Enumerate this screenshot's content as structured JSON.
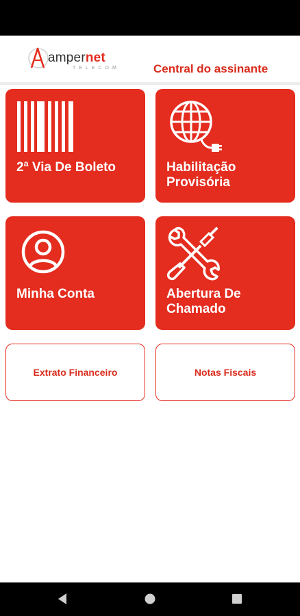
{
  "header": {
    "logo": {
      "brand_prefix": "amper",
      "brand_suffix": "net",
      "tagline": "TELECOM",
      "icon": "ampernet-logo-icon"
    },
    "title": "Central do assinante"
  },
  "tiles": [
    {
      "label": "2ª Via De Boleto",
      "icon": "barcode-icon"
    },
    {
      "label": "Habilitação Provisória",
      "icon": "globe-plug-icon"
    },
    {
      "label": "Minha Conta",
      "icon": "user-account-icon"
    },
    {
      "label": "Abertura De Chamado",
      "icon": "tools-icon"
    }
  ],
  "buttons": [
    {
      "label": "Extrato Financeiro"
    },
    {
      "label": "Notas Fiscais"
    }
  ],
  "navigation": {
    "back": "back-triangle-icon",
    "home": "home-circle-icon",
    "recents": "recents-square-icon"
  },
  "colors": {
    "accent": "#e42c1f",
    "title": "#d92b1c",
    "status_bar": "#000000"
  }
}
